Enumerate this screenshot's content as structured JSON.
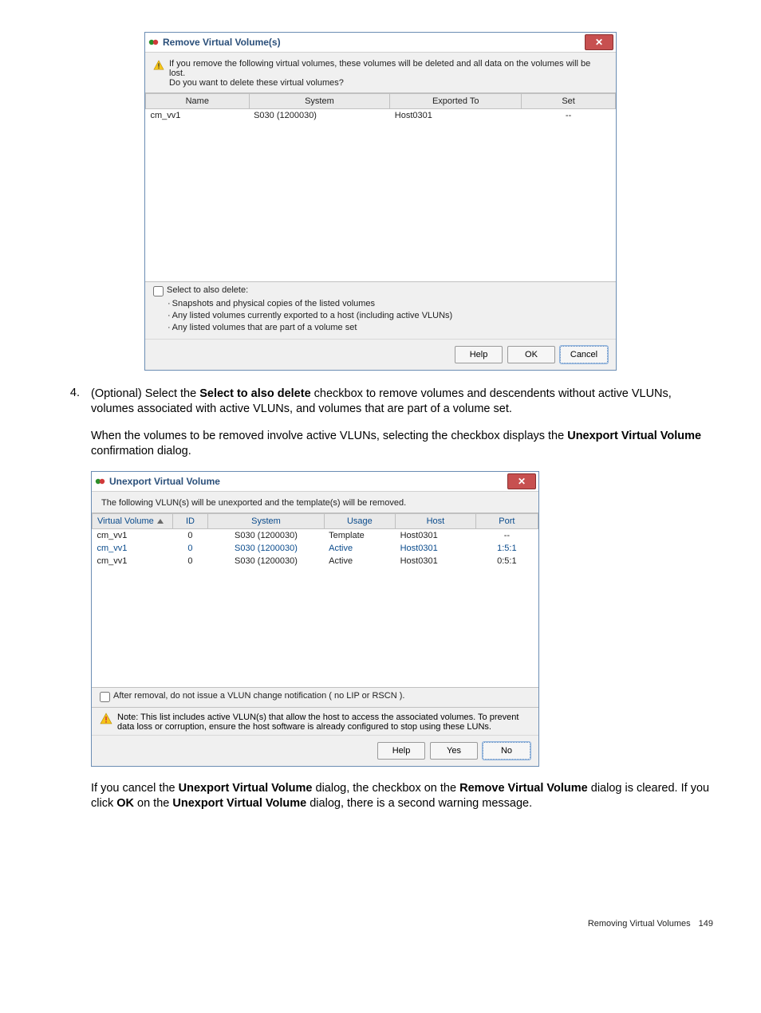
{
  "dialog1": {
    "title": "Remove Virtual Volume(s)",
    "close_glyph": "✕",
    "warning_line1": "If you remove the following virtual volumes, these volumes will be deleted and all data on the volumes will be lost.",
    "warning_line2": "Do you want to delete these virtual volumes?",
    "columns": {
      "name": "Name",
      "system": "System",
      "exported_to": "Exported To",
      "set": "Set"
    },
    "rows": [
      {
        "name": "cm_vv1",
        "system": "S030 (1200030)",
        "exported_to": "Host0301",
        "set": "--"
      }
    ],
    "select_label": "Select to also delete:",
    "sublist": [
      "Snapshots and physical copies of the listed volumes",
      "Any listed volumes currently exported to a host (including active VLUNs)",
      "Any listed volumes that are part of a volume set"
    ],
    "buttons": {
      "help": "Help",
      "ok": "OK",
      "cancel": "Cancel"
    }
  },
  "step4_prefix": "4.",
  "step4_text_a": "(Optional) Select the ",
  "step4_bold_a": "Select to also delete",
  "step4_text_b": " checkbox to remove volumes and descendents without active VLUNs, volumes associated with active VLUNs, and volumes that are part of a volume set.",
  "step4_para2_a": "When the volumes to be removed involve active VLUNs, selecting the checkbox displays the ",
  "step4_para2_bold": "Unexport Virtual Volume",
  "step4_para2_b": " confirmation dialog.",
  "dialog2": {
    "title": "Unexport Virtual Volume",
    "close_glyph": "✕",
    "info_line": "The following VLUN(s) will be unexported and the template(s) will be removed.",
    "columns": {
      "vv": "Virtual Volume",
      "id": "ID",
      "system": "System",
      "usage": "Usage",
      "host": "Host",
      "port": "Port"
    },
    "rows": [
      {
        "vv": "cm_vv1",
        "id": "0",
        "system": "S030 (1200030)",
        "usage": "Template",
        "host": "Host0301",
        "port": "--"
      },
      {
        "vv": "cm_vv1",
        "id": "0",
        "system": "S030 (1200030)",
        "usage": "Active",
        "host": "Host0301",
        "port": "1:5:1"
      },
      {
        "vv": "cm_vv1",
        "id": "0",
        "system": "S030 (1200030)",
        "usage": "Active",
        "host": "Host0301",
        "port": "0:5:1"
      }
    ],
    "after_removal_label": "After removal, do not issue a VLUN change notification ( no LIP or RSCN ).",
    "note_text": "Note: This list includes active VLUN(s) that allow the host to access the associated volumes. To prevent data loss or corruption, ensure the host software is already configured to stop using these LUNs.",
    "buttons": {
      "help": "Help",
      "yes": "Yes",
      "no": "No"
    }
  },
  "closing_a": "If you cancel the ",
  "closing_bold1": "Unexport Virtual Volume",
  "closing_b": " dialog, the checkbox on the ",
  "closing_bold2": "Remove Virtual Volume",
  "closing_c": " dialog is cleared. If you click ",
  "closing_bold3": "OK",
  "closing_d": " on the ",
  "closing_bold4": "Unexport Virtual Volume",
  "closing_e": " dialog, there is a second warning message.",
  "footer": {
    "title": "Removing Virtual Volumes",
    "page": "149"
  }
}
